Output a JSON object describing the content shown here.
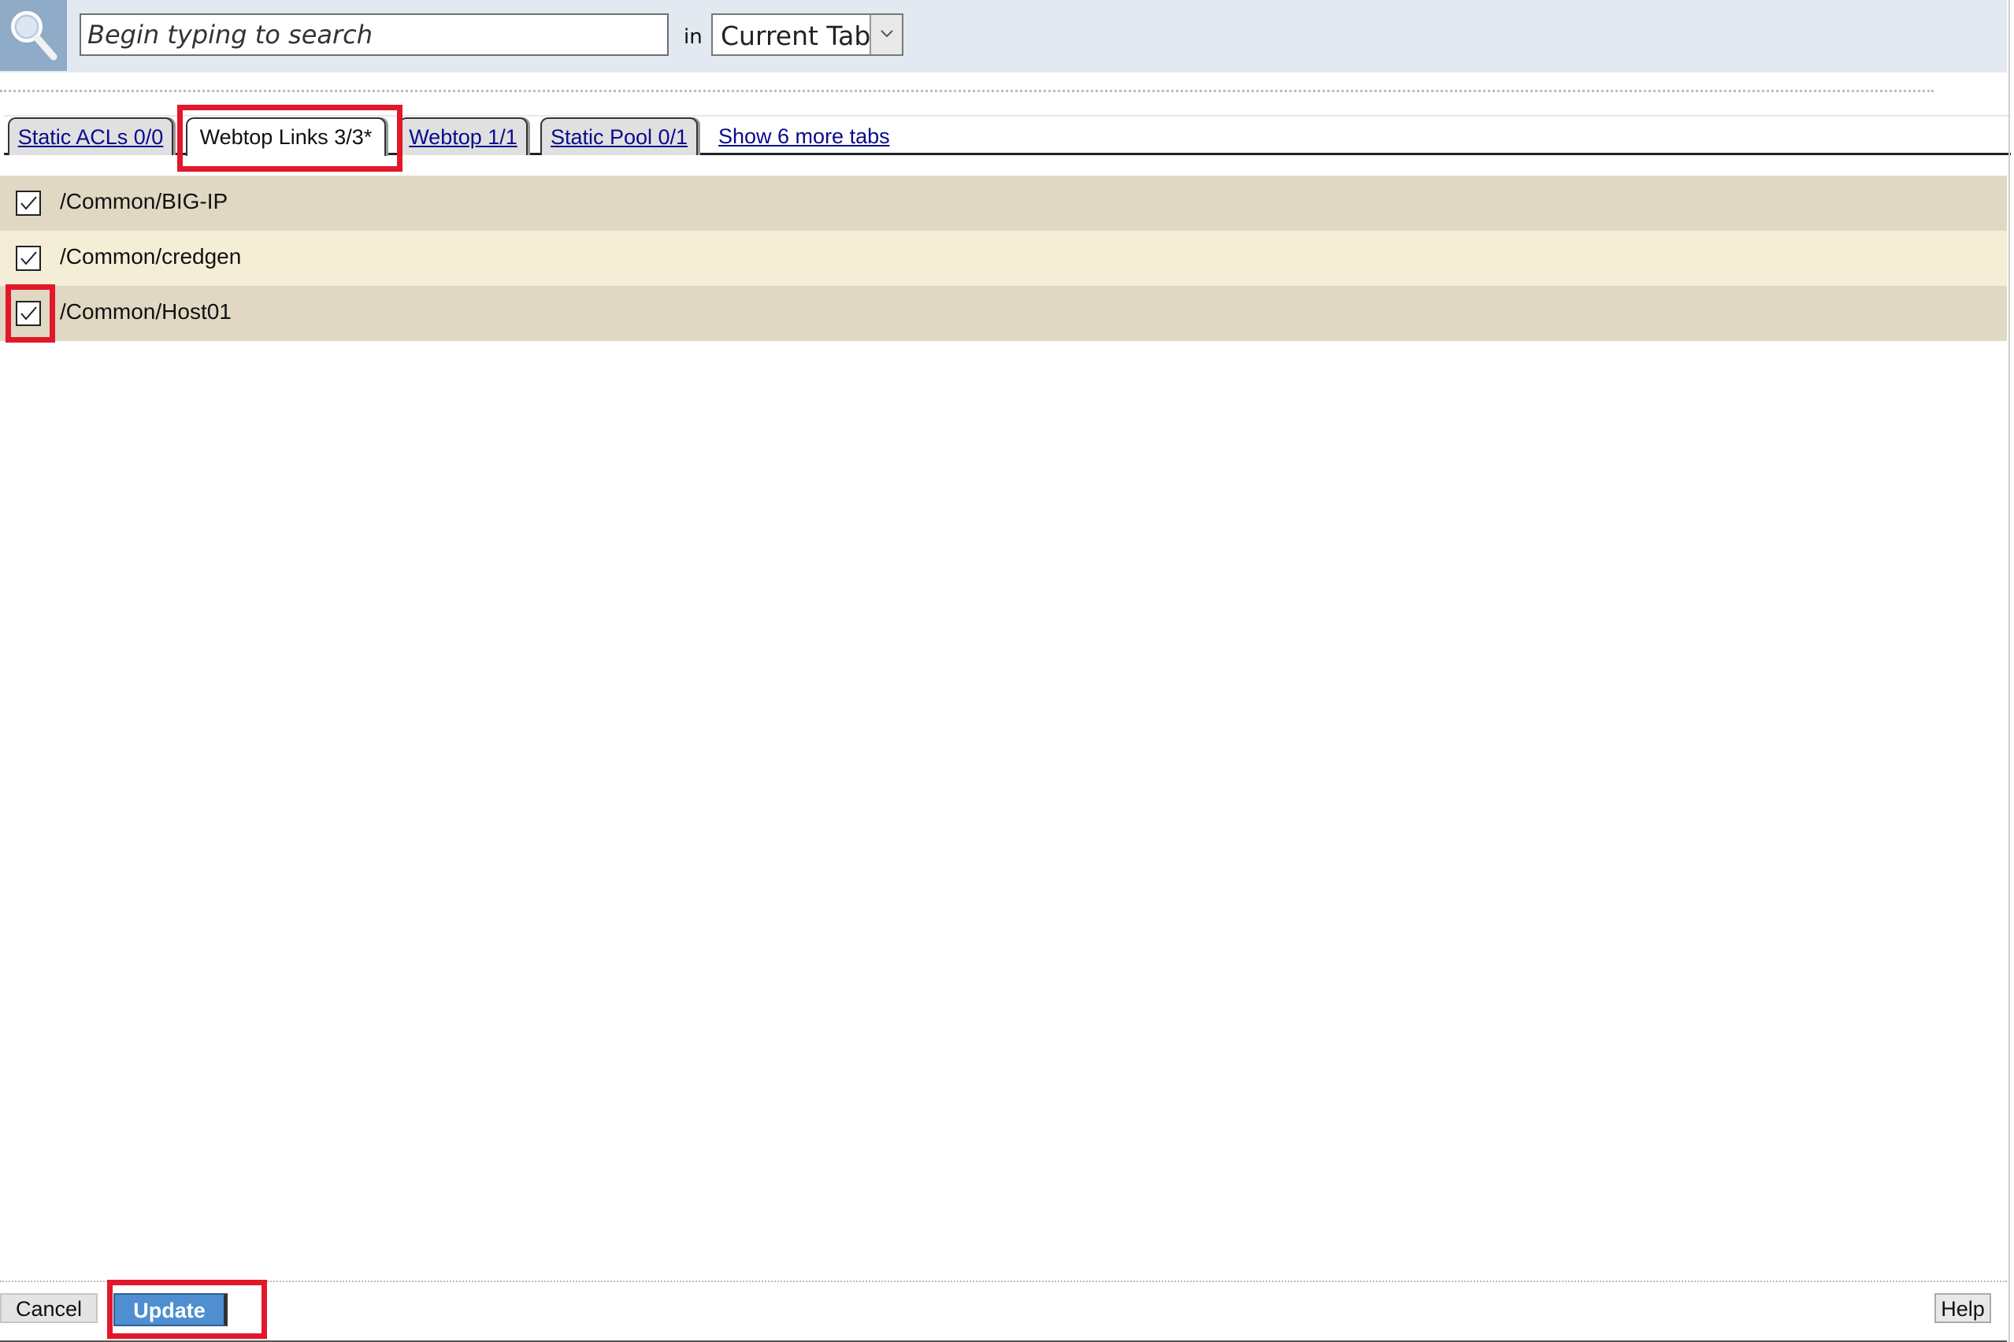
{
  "search": {
    "placeholder": "Begin typing to search",
    "in_label": "in",
    "scope_value": "Current Tab"
  },
  "tabs": [
    {
      "label": "Static ACLs 0/0",
      "active": false
    },
    {
      "label": "Webtop Links 3/3*",
      "active": true
    },
    {
      "label": "Webtop 1/1",
      "active": false
    },
    {
      "label": "Static Pool 0/1",
      "active": false
    }
  ],
  "more_tabs_label": "Show 6 more tabs",
  "items": [
    {
      "label": "/Common/BIG-IP",
      "checked": true
    },
    {
      "label": "/Common/credgen",
      "checked": true
    },
    {
      "label": "/Common/Host01",
      "checked": true
    }
  ],
  "footer": {
    "cancel_label": "Cancel",
    "update_label": "Update",
    "help_label": "Help"
  },
  "colors": {
    "highlight": "#e2172a",
    "row_dark": "#e0d8c3",
    "row_light": "#f5eed7",
    "update_button": "#4f8ed0",
    "link": "#0a0a8c"
  }
}
